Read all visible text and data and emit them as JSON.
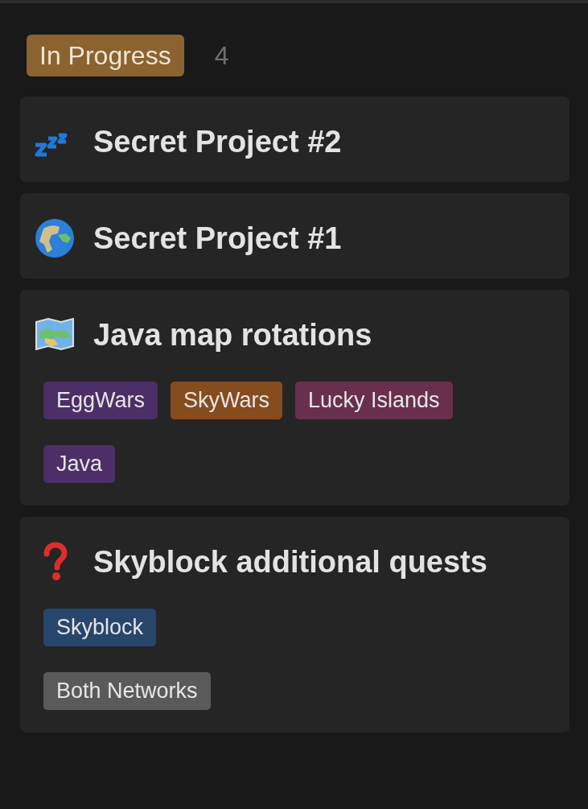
{
  "group": {
    "label": "In Progress",
    "color": "#8a6330",
    "count": "4"
  },
  "cards": [
    {
      "title": "Secret Project #2"
    },
    {
      "title": "Secret Project #1"
    },
    {
      "title": "Java map rotations",
      "tag_rows": [
        [
          {
            "label": "EggWars",
            "color": "#4b2f66"
          },
          {
            "label": "SkyWars",
            "color": "#854c1d"
          },
          {
            "label": "Lucky Islands",
            "color": "#69304d"
          }
        ],
        [
          {
            "label": "Java",
            "color": "#4b2f66"
          }
        ]
      ]
    },
    {
      "title": "Skyblock additional quests",
      "tag_rows": [
        [
          {
            "label": "Skyblock",
            "color": "#28456c"
          }
        ],
        [
          {
            "label": "Both Networks",
            "color": "#5a5a5a"
          }
        ]
      ]
    }
  ]
}
